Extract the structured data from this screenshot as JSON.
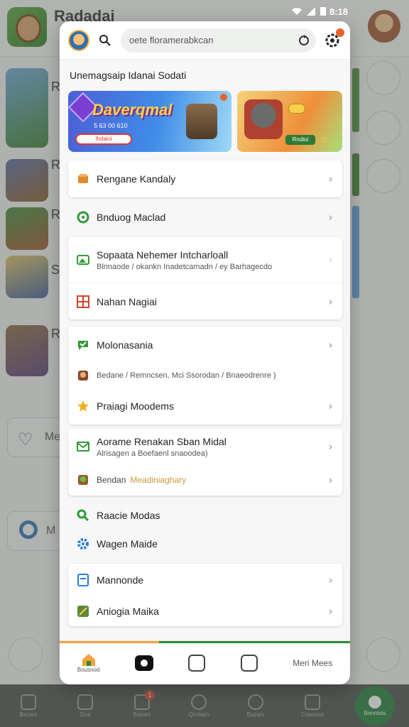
{
  "status_bar": {
    "time": "8:18"
  },
  "background": {
    "app_title": "Radadai",
    "row_letters": [
      "R",
      "R",
      "R",
      "S",
      "R"
    ],
    "card_labels": [
      "Me",
      "M"
    ]
  },
  "modal": {
    "search": {
      "value": "oete floramerabkcan"
    },
    "section_title": "Unemagsaip Idanai Sodati",
    "banner_main": {
      "title": "Daverqmal",
      "sub": "5 63 00 610",
      "button": "Ihdaioi"
    },
    "banner_side": {
      "button": "Rndioi"
    },
    "cards": [
      {
        "items": [
          {
            "label": "Rengane Kandaly",
            "icon": "box-icon",
            "color": "#e08a2e"
          }
        ]
      },
      {
        "items": [
          {
            "label": "Bnduog Maclad",
            "icon": "location-icon",
            "color": "#2f9a3a"
          }
        ]
      },
      {
        "items": [
          {
            "label": "Sopaata Nehemer Intcharloall",
            "sub": "Blnnaode / okankn Inadetcamadn / ey Barhagecdo",
            "icon": "image-icon",
            "color": "#2f9a3a"
          },
          {
            "label": "Nahan Nagiai",
            "icon": "grid-icon",
            "color": "#d2452b"
          }
        ]
      },
      {
        "items": [
          {
            "label": "Molonasania",
            "icon": "chat-icon",
            "color": "#2f9a3a"
          },
          {
            "label": "Bedane / Remncsen, Mci Ssorodan / Bnaeodrenre )",
            "icon": "character-icon",
            "color": "#8a4a2a"
          },
          {
            "label": "Praiagi Moodems",
            "icon": "star-icon",
            "color": "#f0b020"
          }
        ]
      },
      {
        "items": [
          {
            "label": "Aorame Renakan Sban Midal",
            "sub": "Alrisagen a Boefaenl snaoodea)",
            "icon": "mail-icon",
            "color": "#2f9a3a"
          },
          {
            "label": "Bendan",
            "accent": "Meadiniaghary",
            "icon": "hero-icon",
            "color": "#9a5a2a"
          }
        ]
      }
    ],
    "plain_items": [
      {
        "label": "Raacie Modas",
        "icon": "magnify-icon",
        "color": "#2f9a3a"
      },
      {
        "label": "Wagen Maide",
        "icon": "gear-blue-icon",
        "color": "#2a7ad8"
      }
    ],
    "last_card": [
      {
        "label": "Mannonde",
        "icon": "doc-icon",
        "color": "#2a7ad8"
      },
      {
        "label": "Aniogia Maika",
        "icon": "game-icon",
        "color": "#5a8a3a"
      }
    ],
    "bottom_bar": {
      "home_label": "Bousnod",
      "more_label": "Meri Mees"
    }
  },
  "bottom_nav": {
    "labels": [
      "Bazam",
      "Sioa",
      "Bazam",
      "Qorbain",
      "Bazam",
      "Caaosne",
      "Benmsis"
    ],
    "badge": "1"
  },
  "colors": {
    "accent_green": "#1f7a34",
    "badge_orange": "#e8632b"
  }
}
